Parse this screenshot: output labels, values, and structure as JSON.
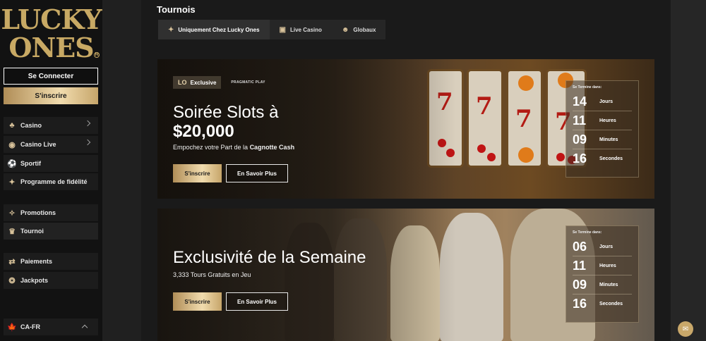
{
  "brand": {
    "line1": "LUCKY",
    "line2": "ONES",
    "reg": "R"
  },
  "auth": {
    "login": "Se Connecter",
    "signup": "S'inscrire"
  },
  "sidebar": {
    "items": [
      {
        "label": "Casino",
        "icon": "cards-icon"
      },
      {
        "label": "Casino Live",
        "icon": "live-icon"
      },
      {
        "label": "Sportif",
        "icon": "sports-icon"
      },
      {
        "label": "Programme de fidélité",
        "icon": "star-icon"
      },
      {
        "label": "Promotions",
        "icon": "party-icon"
      },
      {
        "label": "Tournoi",
        "icon": "trophy-icon"
      },
      {
        "label": "Paiements",
        "icon": "transfer-icon"
      },
      {
        "label": "Jackpots",
        "icon": "jackpot-icon"
      },
      {
        "label": "CA-FR",
        "icon": "canada-flag-icon"
      }
    ]
  },
  "page": {
    "title": "Tournois"
  },
  "tabs": [
    {
      "label": "Uniquement Chez Lucky Ones"
    },
    {
      "label": "Live Casino"
    },
    {
      "label": "Globaux"
    }
  ],
  "banners": [
    {
      "badge": "Exclusive",
      "partner": "PRAGMATIC PLAY",
      "title_line1": "Soirée Slots à",
      "title_line2": "$20,000",
      "subtitle_prefix": "Empochez votre Part de la ",
      "subtitle_bold": "Cagnotte Cash",
      "signup": "S'inscrire",
      "more": "En Savoir Plus",
      "timer": {
        "label": "Se Termine dans:",
        "rows": [
          {
            "num": "14",
            "unit": "Jours"
          },
          {
            "num": "11",
            "unit": "Heures"
          },
          {
            "num": "09",
            "unit": "Minutes"
          },
          {
            "num": "16",
            "unit": "Secondes"
          }
        ]
      }
    },
    {
      "title_line1": "Exclusivité de la Semaine",
      "subtitle": "3,333 Tours Gratuits en Jeu",
      "signup": "S'inscrire",
      "more": "En Savoir Plus",
      "timer": {
        "label": "Se Termine dans:",
        "rows": [
          {
            "num": "06",
            "unit": "Jours"
          },
          {
            "num": "11",
            "unit": "Heures"
          },
          {
            "num": "09",
            "unit": "Minutes"
          },
          {
            "num": "16",
            "unit": "Secondes"
          }
        ]
      }
    }
  ],
  "colors": {
    "gold": "#c8a964",
    "background": "#1a1a1a",
    "sidebar": "#121212"
  }
}
